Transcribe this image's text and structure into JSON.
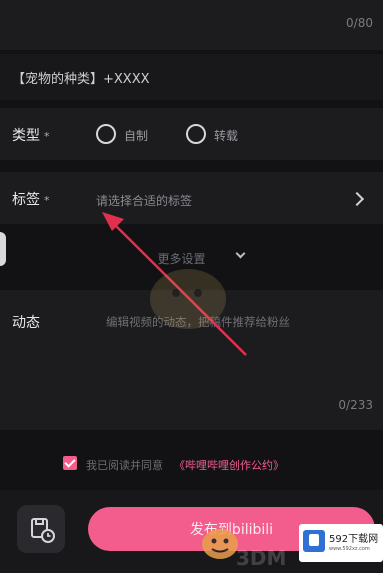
{
  "title_counter": "0/80",
  "topic_text": "【宠物的种类】+XXXX",
  "type_field": {
    "label": "类型",
    "required_mark": "*",
    "options": [
      "自制",
      "转载"
    ]
  },
  "tag_field": {
    "label": "标签",
    "required_mark": "*",
    "placeholder": "请选择合适的标签"
  },
  "more_settings": "更多设置",
  "dynamic_field": {
    "label": "动态",
    "placeholder": "编辑视频的动态，把稿件推荐给粉丝",
    "counter": "0/233"
  },
  "agreement": {
    "prefix": "我已阅读并同意",
    "link": "《哔哩哔哩创作公约》"
  },
  "publish_button": "发布到bilibili",
  "watermark": {
    "brand": "3DM",
    "site_label": "592下载网",
    "site_url": "www.592xz.com"
  },
  "colors": {
    "background": "#121214",
    "panel": "#1c1c1f",
    "accent": "#f25d8e",
    "annotation_arrow": "#e0304e"
  },
  "icons": [
    "chevron-right-icon",
    "chevron-down-icon",
    "checkbox-checked-icon",
    "draft-save-icon",
    "annotation-arrow"
  ]
}
